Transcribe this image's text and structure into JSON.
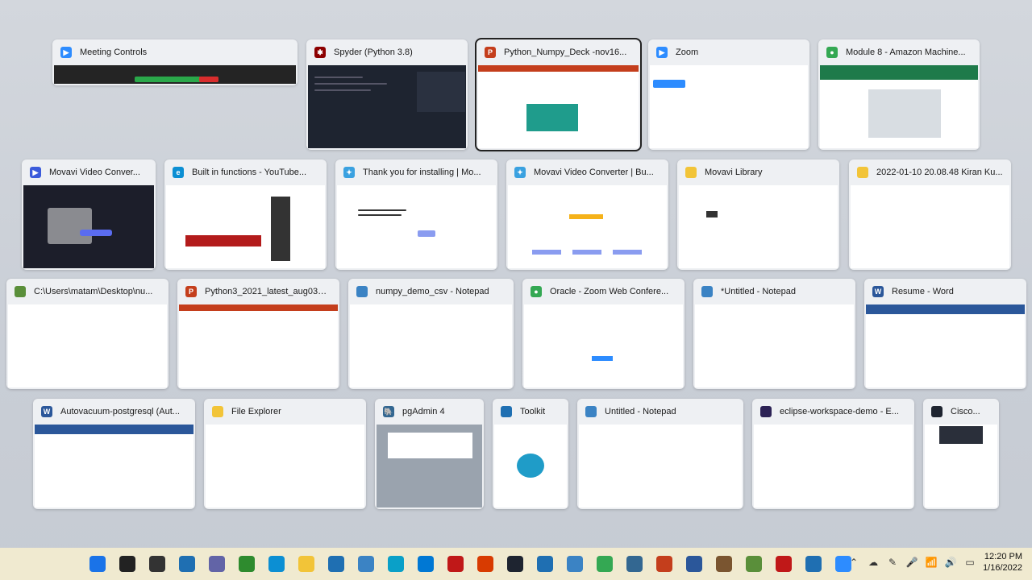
{
  "windows": [
    {
      "title": "Meeting Controls",
      "icon": "zoom-icon",
      "color": "#2d8cff"
    },
    {
      "title": "Spyder (Python 3.8)",
      "icon": "spyder-icon",
      "color": "#8c0000"
    },
    {
      "title": "Python_Numpy_Deck -nov16...",
      "icon": "powerpoint-icon",
      "color": "#c43e1c"
    },
    {
      "title": "Zoom",
      "icon": "zoom-icon",
      "color": "#2d8cff"
    },
    {
      "title": "Module 8 - Amazon Machine...",
      "icon": "chrome-icon",
      "color": "#34a853"
    },
    {
      "title": "Movavi Video Conver...",
      "icon": "movavi-icon",
      "color": "#3b5bdb"
    },
    {
      "title": "Built in functions - YouTube...",
      "icon": "edge-icon",
      "color": "#0c8fd3"
    },
    {
      "title": "Thank you for installing | Mo...",
      "icon": "movavi-icon",
      "color": "#3aa1e0"
    },
    {
      "title": "Movavi Video Converter | Bu...",
      "icon": "movavi-icon",
      "color": "#3aa1e0"
    },
    {
      "title": "Movavi Library",
      "icon": "folder-icon",
      "color": "#f2c438"
    },
    {
      "title": "2022-01-10 20.08.48 Kiran Ku...",
      "icon": "folder-icon",
      "color": "#f2c438"
    },
    {
      "title": "C:\\Users\\matam\\Desktop\\nu...",
      "icon": "csv-icon",
      "color": "#5a8f3a"
    },
    {
      "title": "Python3_2021_latest_aug03_1...",
      "icon": "powerpoint-icon",
      "color": "#c43e1c"
    },
    {
      "title": "numpy_demo_csv - Notepad",
      "icon": "notepad-icon",
      "color": "#3b83c4"
    },
    {
      "title": "Oracle - Zoom Web Confere...",
      "icon": "chrome-icon",
      "color": "#34a853"
    },
    {
      "title": "*Untitled - Notepad",
      "icon": "notepad-icon",
      "color": "#3b83c4"
    },
    {
      "title": "Resume - Word",
      "icon": "word-icon",
      "color": "#2b579a"
    },
    {
      "title": "Autovacuum-postgresql (Aut...",
      "icon": "word-icon",
      "color": "#2b579a"
    },
    {
      "title": "File Explorer",
      "icon": "folder-icon",
      "color": "#f2c438"
    },
    {
      "title": "pgAdmin 4",
      "icon": "pgadmin-icon",
      "color": "#336791"
    },
    {
      "title": "Toolkit",
      "icon": "toolkit-icon",
      "color": "#1f6fb2"
    },
    {
      "title": "Untitled - Notepad",
      "icon": "notepad-icon",
      "color": "#3b83c4"
    },
    {
      "title": "eclipse-workspace-demo - E...",
      "icon": "eclipse-icon",
      "color": "#2c2255"
    },
    {
      "title": "Cisco...",
      "icon": "cisco-icon",
      "color": "#1e2430"
    }
  ],
  "taskbar": {
    "icons": [
      {
        "name": "start-icon",
        "color": "#1a73e8"
      },
      {
        "name": "search-icon",
        "color": "#222222"
      },
      {
        "name": "task-view-icon",
        "color": "#333333"
      },
      {
        "name": "widgets-icon",
        "color": "#1f6fb2"
      },
      {
        "name": "teams-chat-icon",
        "color": "#6264a7"
      },
      {
        "name": "green-app-icon",
        "color": "#2e8b2e"
      },
      {
        "name": "edge-icon",
        "color": "#0c8fd3"
      },
      {
        "name": "file-explorer-icon",
        "color": "#f2c438"
      },
      {
        "name": "mail-icon",
        "color": "#1f6fb2"
      },
      {
        "name": "store-icon",
        "color": "#3b83c4"
      },
      {
        "name": "learning-icon",
        "color": "#0aa0c8"
      },
      {
        "name": "outlook-icon",
        "color": "#0078d4"
      },
      {
        "name": "mcafee-icon",
        "color": "#c01818"
      },
      {
        "name": "office-icon",
        "color": "#d83b01"
      },
      {
        "name": "terminal-icon",
        "color": "#1e2430"
      },
      {
        "name": "movavi-icon",
        "color": "#1f6fb2"
      },
      {
        "name": "notepad-icon",
        "color": "#3b83c4"
      },
      {
        "name": "chrome-icon",
        "color": "#34a853"
      },
      {
        "name": "pgadmin-icon",
        "color": "#336791"
      },
      {
        "name": "powerpoint-icon",
        "color": "#c43e1c"
      },
      {
        "name": "word-icon",
        "color": "#2b579a"
      },
      {
        "name": "game-icon",
        "color": "#7a5530"
      },
      {
        "name": "csv-icon",
        "color": "#5a8f3a"
      },
      {
        "name": "python-icon",
        "color": "#c01818"
      },
      {
        "name": "toolkit-icon",
        "color": "#1f6fb2"
      },
      {
        "name": "zoom-icon",
        "color": "#2d8cff"
      }
    ],
    "tray": {
      "time": "12:20 PM",
      "date": "1/16/2022"
    }
  }
}
